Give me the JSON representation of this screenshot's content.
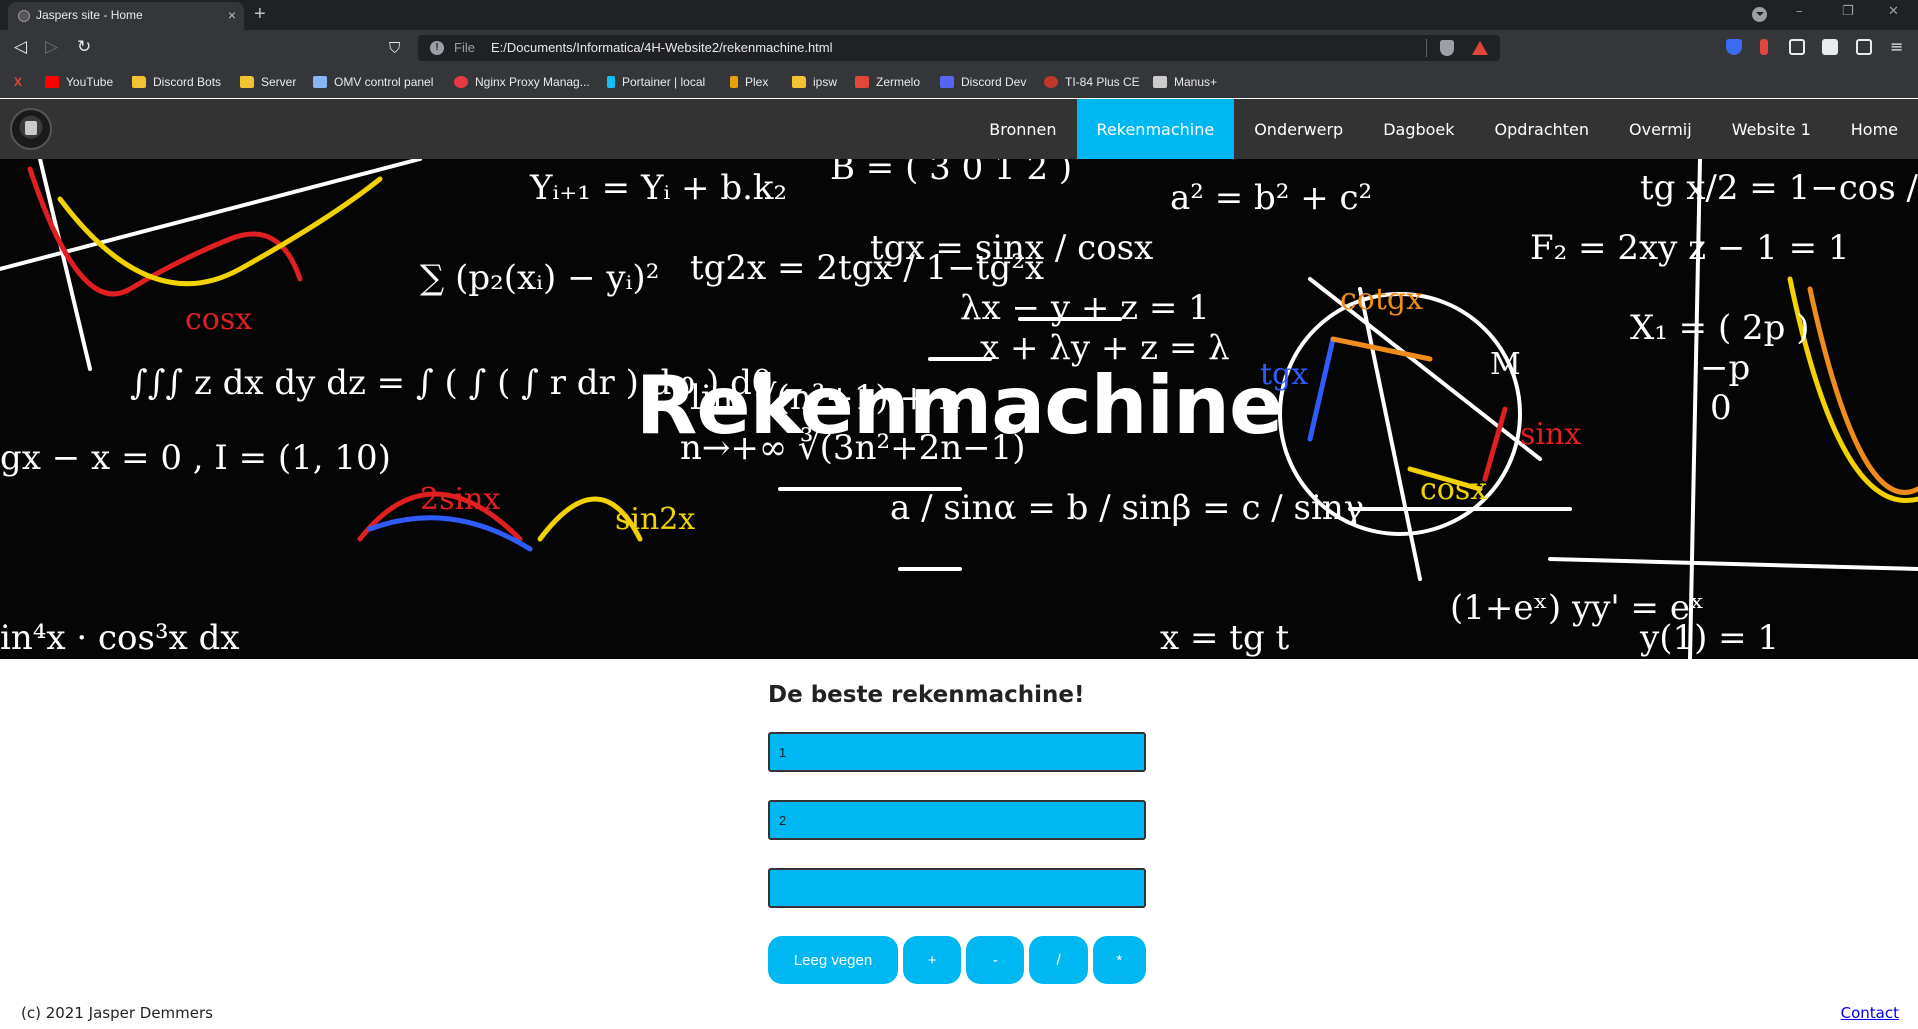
{
  "browser": {
    "tab_title": "Jaspers site - Home",
    "tab_close": "×",
    "new_tab": "+",
    "url_scheme": "File",
    "url": "E:/Documents/Informatica/4H-Website2/rekenmachine.html",
    "window_controls": [
      "–",
      "❐",
      "✕"
    ],
    "nav_back": "◁",
    "nav_forward": "▷",
    "nav_reload": "↻",
    "bookmark_star": "⛉",
    "menu_icon": "≡",
    "bookmarks": [
      {
        "label": "YouTube",
        "icon": "youtube-icon",
        "color": "#ff0000"
      },
      {
        "label": "Discord Bots",
        "icon": "folder-icon",
        "color": "#f1c232"
      },
      {
        "label": "Server",
        "icon": "folder-icon",
        "color": "#f1c232"
      },
      {
        "label": "OMV control panel",
        "icon": "page-icon",
        "color": "#8ab4f8"
      },
      {
        "label": "Nginx Proxy Manag...",
        "icon": "nginx-icon",
        "color": "#e63946"
      },
      {
        "label": "Portainer | local",
        "icon": "portainer-icon",
        "color": "#13bef9"
      },
      {
        "label": "Plex",
        "icon": "plex-icon",
        "color": "#e5a00d"
      },
      {
        "label": "ipsw",
        "icon": "folder-icon",
        "color": "#f1c232"
      },
      {
        "label": "Zermelo",
        "icon": "zermelo-icon",
        "color": "#e0463a"
      },
      {
        "label": "Discord Dev",
        "icon": "discord-icon",
        "color": "#5865f2"
      },
      {
        "label": "TI-84 Plus CE",
        "icon": "ti-icon",
        "color": "#c0392b"
      },
      {
        "label": "Manus+",
        "icon": "manus-icon",
        "color": "#cccccc"
      }
    ]
  },
  "site": {
    "menu": [
      "Bronnen",
      "Rekenmachine",
      "Onderwerp",
      "Dagboek",
      "Opdrachten",
      "Overmij",
      "Website 1",
      "Home"
    ],
    "active_menu": "Rekenmachine",
    "accent": "#00b8f1",
    "hero_title": "Rekenmachine",
    "calc_title": "De beste rekenmachine!",
    "input1_value": "1",
    "input2_value": "2",
    "result_value": "",
    "buttons": {
      "clear": "Leeg vegen",
      "add": "+",
      "subtract": "-",
      "divide": "/",
      "multiply": "*"
    },
    "copyright": "(c) 2021 Jasper Demmers",
    "contact": "Contact"
  }
}
